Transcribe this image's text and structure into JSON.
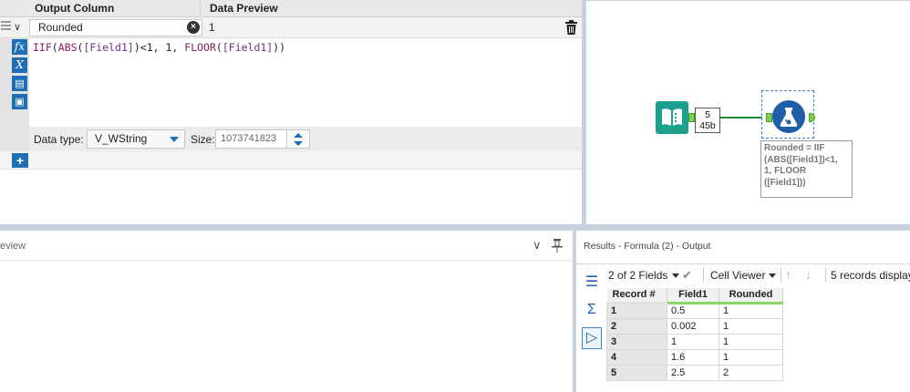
{
  "formula_panel": {
    "header": {
      "output_column": "Output Column",
      "data_preview": "Data Preview"
    },
    "row": {
      "output_value": "Rounded",
      "preview_value": "1",
      "expression_parts": [
        "IIF",
        "(",
        "ABS",
        "(",
        "[Field1]",
        ")<",
        "1",
        ", ",
        "1",
        ", ",
        "FLOOR",
        "(",
        "[Field1]",
        "))"
      ]
    },
    "data_type_label": "Data type:",
    "data_type_value": "V_WString",
    "size_label": "Size:",
    "size_value": "1073741823",
    "side_icons": [
      "fx",
      "X",
      "open-icon",
      "save-icon"
    ]
  },
  "canvas": {
    "count_records": "5",
    "count_size": "45b",
    "annotation": "Rounded = IIF\n(ABS([Field1])<1,\n1, FLOOR\n([Field1]))"
  },
  "left_pane": {
    "title": "eview"
  },
  "results": {
    "title": "Results - Formula (2) - Output",
    "fields_selector": "2 of 2 Fields",
    "viewer": "Cell Viewer",
    "records_text": "5 records displaye",
    "columns": [
      "Record #",
      "Field1",
      "Rounded"
    ],
    "rows": [
      {
        "record": "1",
        "field1": "0.5",
        "rounded": "1"
      },
      {
        "record": "2",
        "field1": "0.002",
        "rounded": "1"
      },
      {
        "record": "3",
        "field1": "1",
        "rounded": "1"
      },
      {
        "record": "4",
        "field1": "1.6",
        "rounded": "1"
      },
      {
        "record": "5",
        "field1": "2.5",
        "rounded": "2"
      }
    ]
  },
  "colors": {
    "accent_blue": "#1e6fb5",
    "tool_green": "#1aa08d",
    "connection_green": "#1c8b36",
    "header_green_line": "#8bd46a"
  }
}
